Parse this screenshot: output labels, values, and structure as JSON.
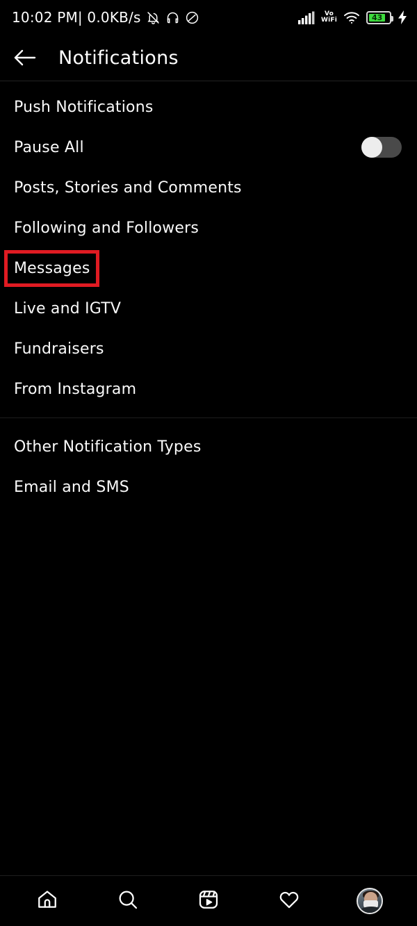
{
  "statusbar": {
    "time_and_speed": "10:02 PM| 0.0KB/s",
    "icons_left": [
      "bell-muted-icon",
      "headphones-icon",
      "dnd-icon"
    ],
    "network_label": "Vo WiFi",
    "vo_text": "Vo",
    "wifi_text": "WiFi",
    "battery_percent": "43",
    "icons_right": [
      "signal-bars-icon",
      "vowifi-icon",
      "wifi-icon",
      "battery-icon",
      "charging-bolt-icon"
    ]
  },
  "header": {
    "back_icon": "back-arrow-icon",
    "title": "Notifications"
  },
  "groups": [
    {
      "id": "push-notifications",
      "rows": [
        {
          "label": "Push Notifications",
          "type": "section"
        },
        {
          "label": "Pause All",
          "type": "toggle",
          "toggle_state": "off"
        },
        {
          "label": "Posts, Stories and Comments",
          "type": "item"
        },
        {
          "label": "Following and Followers",
          "type": "item"
        },
        {
          "label": "Messages",
          "type": "item",
          "highlight": true
        },
        {
          "label": "Live and IGTV",
          "type": "item"
        },
        {
          "label": "Fundraisers",
          "type": "item"
        },
        {
          "label": "From Instagram",
          "type": "item"
        }
      ]
    },
    {
      "id": "other-notification-types",
      "rows": [
        {
          "label": "Other Notification Types",
          "type": "section"
        },
        {
          "label": "Email and SMS",
          "type": "item"
        }
      ]
    }
  ],
  "bottomnav": {
    "items": [
      {
        "name": "home-icon",
        "label": "Home"
      },
      {
        "name": "search-icon",
        "label": "Search"
      },
      {
        "name": "reels-icon",
        "label": "Reels"
      },
      {
        "name": "heart-icon",
        "label": "Activity"
      },
      {
        "name": "profile-avatar",
        "label": "Profile"
      }
    ]
  },
  "colors": {
    "background": "#000000",
    "text": "#fafafa",
    "highlight_red": "#e01b22",
    "divider": "#1e1e1e",
    "battery_green": "#3ddc3d",
    "toggle_track": "#4a4a4a",
    "toggle_knob": "#ededed"
  }
}
